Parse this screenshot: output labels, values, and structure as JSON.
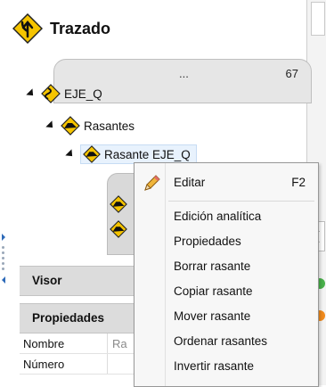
{
  "header": {
    "title": "Trazado",
    "icon": "road-merge-sign-icon"
  },
  "group": {
    "ellipsis": "...",
    "count": "67"
  },
  "tree": {
    "axis": {
      "label": "EJE_Q",
      "icon": "axis-curve-sign-icon"
    },
    "folder": {
      "label": "Rasantes",
      "icon": "profile-sign-icon"
    },
    "item": {
      "label": "Rasante EJE_Q",
      "icon": "profile-sign-icon"
    }
  },
  "panels": {
    "visor": "Visor",
    "propiedades": "Propiedades"
  },
  "properties": [
    {
      "name": "Nombre",
      "value": "Ra"
    },
    {
      "name": "Número",
      "value": ""
    }
  ],
  "context_menu": {
    "items": [
      {
        "label": "Editar",
        "shortcut": "F2",
        "icon": "pencil-icon"
      },
      {
        "label": "Edición analítica"
      },
      {
        "label": "Propiedades"
      },
      {
        "label": "Borrar rasante"
      },
      {
        "label": "Copiar rasante"
      },
      {
        "label": "Mover rasante"
      },
      {
        "label": "Ordenar rasantes"
      },
      {
        "label": "Invertir rasante"
      }
    ]
  },
  "colors": {
    "sign_yellow": "#f5c400",
    "selection": "#e8f2fd",
    "panel_gray": "#dcdcdc",
    "accent_blue": "#2d6ab8"
  }
}
